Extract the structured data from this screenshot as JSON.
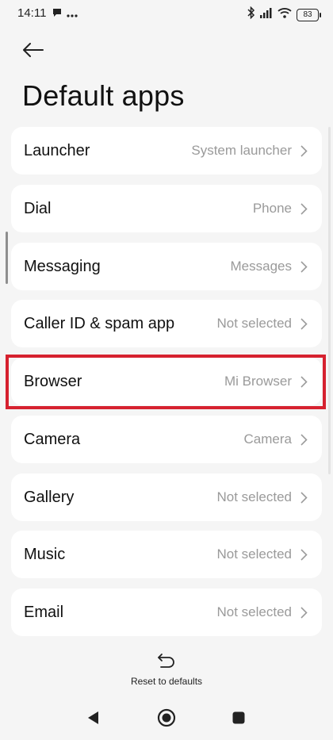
{
  "status_bar": {
    "time": "14:11",
    "battery": "83",
    "icons": [
      "chat-bubble-icon",
      "more-dots-icon",
      "bluetooth-icon",
      "signal-icon",
      "wifi-icon",
      "battery-icon"
    ]
  },
  "header": {
    "title": "Default apps"
  },
  "items": [
    {
      "label": "Launcher",
      "value": "System launcher"
    },
    {
      "label": "Dial",
      "value": "Phone"
    },
    {
      "label": "Messaging",
      "value": "Messages"
    },
    {
      "label": "Caller ID & spam app",
      "value": "Not selected"
    },
    {
      "label": "Browser",
      "value": "Mi Browser"
    },
    {
      "label": "Camera",
      "value": "Camera"
    },
    {
      "label": "Gallery",
      "value": "Not selected"
    },
    {
      "label": "Music",
      "value": "Not selected"
    },
    {
      "label": "Email",
      "value": "Not selected"
    }
  ],
  "highlighted_item": "Browser",
  "footer": {
    "reset_label": "Reset to defaults"
  },
  "colors": {
    "background": "#f5f5f5",
    "card": "#ffffff",
    "highlight": "#d6212f",
    "secondary_text": "#9a9a9a"
  }
}
